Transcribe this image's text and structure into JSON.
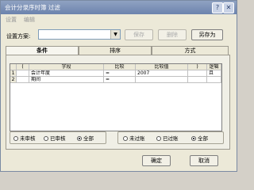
{
  "window": {
    "title": "会计分录序时簿 过滤"
  },
  "titlebar_buttons": {
    "help_label": "?",
    "close_label": "✕"
  },
  "menu": [
    "设置",
    "编辑"
  ],
  "plan": {
    "label": "设置方案:",
    "value": "",
    "save_label": "保存",
    "delete_label": "删除",
    "save_as_label": "另存为"
  },
  "tabs": [
    {
      "label": "条件",
      "active": true
    },
    {
      "label": "排序",
      "active": false
    },
    {
      "label": "方式",
      "active": false
    }
  ],
  "grid": {
    "columns": [
      "(",
      "字段",
      "比较",
      "比较值",
      ")",
      "逻辑"
    ],
    "rows": [
      {
        "num": "1",
        "lparen": "",
        "field": "会计年度",
        "op": "=",
        "value": "2007",
        "rparen": "",
        "logic": "且"
      },
      {
        "num": "2",
        "lparen": "",
        "field": "期间",
        "op": "=",
        "value": "",
        "rparen": "",
        "logic": ""
      }
    ]
  },
  "audit_options": {
    "unaudited": "未审核",
    "audited": "已审核",
    "all": "全部",
    "selected": "all"
  },
  "posting_options": {
    "unposted": "未过账",
    "posted": "已过账",
    "all": "全部",
    "selected": "all"
  },
  "footer": {
    "ok_label": "确定",
    "cancel_label": "取消"
  }
}
